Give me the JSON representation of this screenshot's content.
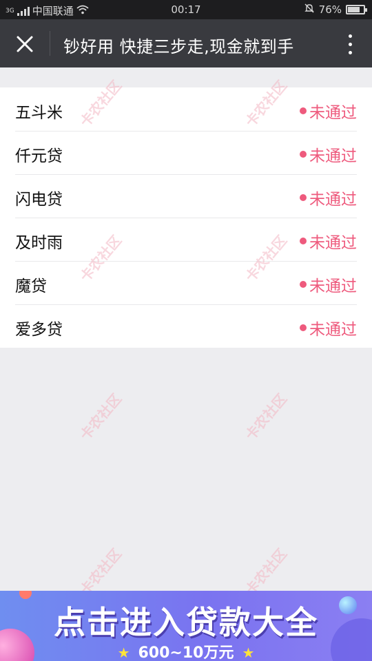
{
  "status_bar": {
    "carrier_badge": "3G",
    "carrier": "中国联通",
    "time": "00:17",
    "battery_text": "76%",
    "battery_level": 0.76
  },
  "nav": {
    "title": "钞好用 快捷三步走,现金就到手",
    "background": "#393a3f"
  },
  "list": {
    "items": [
      {
        "name": "五斗米",
        "status": "未通过"
      },
      {
        "name": "仟元贷",
        "status": "未通过"
      },
      {
        "name": "闪电贷",
        "status": "未通过"
      },
      {
        "name": "及时雨",
        "status": "未通过"
      },
      {
        "name": "魔贷",
        "status": "未通过"
      },
      {
        "name": "爱多贷",
        "status": "未通过"
      }
    ],
    "status_color": "#ee5a7d"
  },
  "watermark": {
    "text": "卡农社区"
  },
  "banner": {
    "title": "点击进入贷款大全",
    "subtitle": "600~10万元",
    "star": "★"
  }
}
